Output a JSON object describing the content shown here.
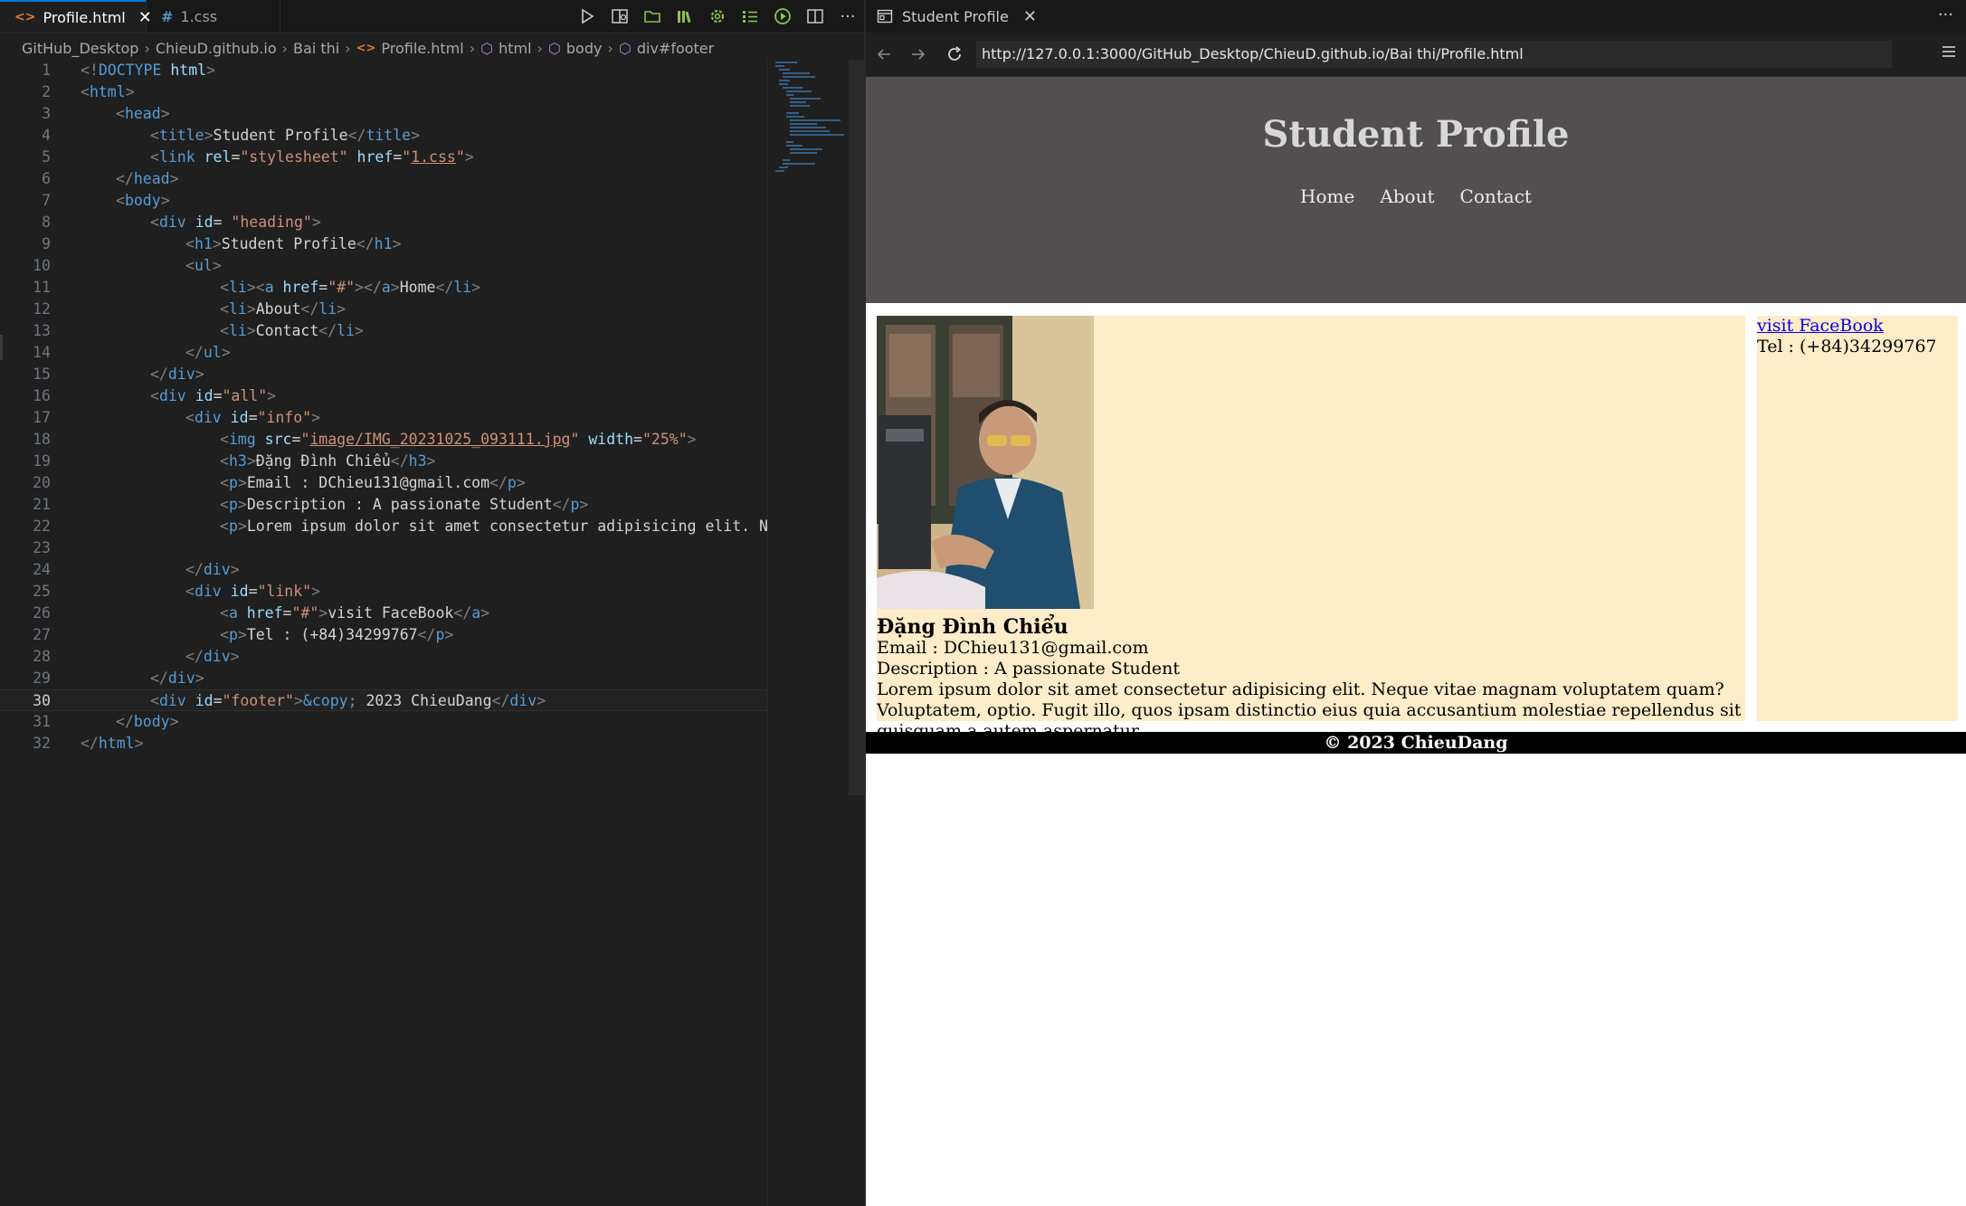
{
  "editor": {
    "tabs": [
      {
        "icon": "<>",
        "label": "Profile.html",
        "active": true
      },
      {
        "icon": "#",
        "label": "1.css",
        "active": false
      }
    ],
    "breadcrumb": [
      "GitHub_Desktop",
      "ChieuD.github.io",
      "Bai thi",
      "Profile.html",
      "html",
      "body",
      "div#footer"
    ],
    "current_line": 30,
    "line_numbers": [
      "1",
      "2",
      "3",
      "4",
      "5",
      "6",
      "7",
      "8",
      "9",
      "10",
      "11",
      "12",
      "13",
      "14",
      "15",
      "16",
      "17",
      "18",
      "19",
      "20",
      "21",
      "22",
      "23",
      "24",
      "25",
      "26",
      "27",
      "28",
      "29",
      "30",
      "31",
      "32"
    ]
  },
  "code": {
    "l1": {
      "a": "<!",
      "b": "DOCTYPE",
      "c": " html",
      "d": ">"
    },
    "l2": {
      "a": "<",
      "b": "html",
      "c": ">"
    },
    "l3": {
      "a": "<",
      "b": "head",
      "c": ">"
    },
    "l4": {
      "a": "<",
      "b": "title",
      "c": ">",
      "d": "Student Profile",
      "e": "</",
      "f": "title",
      "g": ">"
    },
    "l5": {
      "a": "<",
      "b": "link",
      "c": " rel",
      "d": "=",
      "e": "\"stylesheet\"",
      "f": " href",
      "g": "=",
      "h": "\"",
      "i": "1.css",
      "j": "\"",
      "k": ">"
    },
    "l6": {
      "a": "</",
      "b": "head",
      "c": ">"
    },
    "l7": {
      "a": "<",
      "b": "body",
      "c": ">"
    },
    "l8": {
      "a": "<",
      "b": "div",
      "c": " id",
      "d": "=",
      "e": " \"heading\"",
      "f": ">"
    },
    "l9": {
      "a": "<",
      "b": "h1",
      "c": ">",
      "d": "Student Profile",
      "e": "</",
      "f": "h1",
      "g": ">"
    },
    "l10": {
      "a": "<",
      "b": "ul",
      "c": ">"
    },
    "l11": {
      "a": "<",
      "b": "li",
      "c": "><",
      "d": "a",
      "e": " href",
      "f": "=",
      "g": "\"#\"",
      "h": "></",
      "i": "a",
      "j": ">",
      "k": "Home",
      "l": "</",
      "m": "li",
      "n": ">"
    },
    "l12": {
      "a": "<",
      "b": "li",
      "c": ">",
      "d": "About",
      "e": "</",
      "f": "li",
      "g": ">"
    },
    "l13": {
      "a": "<",
      "b": "li",
      "c": ">",
      "d": "Contact",
      "e": "</",
      "f": "li",
      "g": ">"
    },
    "l14": {
      "a": "</",
      "b": "ul",
      "c": ">"
    },
    "l15": {
      "a": "</",
      "b": "div",
      "c": ">"
    },
    "l16": {
      "a": "<",
      "b": "div",
      "c": " id",
      "d": "=",
      "e": "\"all\"",
      "f": ">"
    },
    "l17": {
      "a": "<",
      "b": "div",
      "c": " id",
      "d": "=",
      "e": "\"info\"",
      "f": ">"
    },
    "l18": {
      "a": "<",
      "b": "img",
      "c": " src",
      "d": "=",
      "e": "\"",
      "f": "image/IMG_20231025_093111.jpg",
      "g": "\"",
      "h": " width",
      "i": "=",
      "j": "\"25%\"",
      "k": ">"
    },
    "l19": {
      "a": "<",
      "b": "h3",
      "c": ">",
      "d": "Đặng Đình Chiểu",
      "e": "</",
      "f": "h3",
      "g": ">"
    },
    "l20": {
      "a": "<",
      "b": "p",
      "c": ">",
      "d": "Email : DChieu131@gmail.com",
      "e": "</",
      "f": "p",
      "g": ">"
    },
    "l21": {
      "a": "<",
      "b": "p",
      "c": ">",
      "d": "Description : A passionate Student",
      "e": "</",
      "f": "p",
      "g": ">"
    },
    "l22": {
      "a": "<",
      "b": "p",
      "c": ">",
      "d": "Lorem ipsum dolor sit amet consectetur adipisicing elit. Neq"
    },
    "l24": {
      "a": "</",
      "b": "div",
      "c": ">"
    },
    "l25": {
      "a": "<",
      "b": "div",
      "c": " id",
      "d": "=",
      "e": "\"link\"",
      "f": ">"
    },
    "l26": {
      "a": "<",
      "b": "a",
      "c": " href",
      "d": "=",
      "e": "\"#\"",
      "f": ">",
      "g": "visit FaceBook",
      "h": "</",
      "i": "a",
      "j": ">"
    },
    "l27": {
      "a": "<",
      "b": "p",
      "c": ">",
      "d": "Tel : (+84)34299767",
      "e": "</",
      "f": "p",
      "g": ">"
    },
    "l28": {
      "a": "</",
      "b": "div",
      "c": ">"
    },
    "l29": {
      "a": "</",
      "b": "div",
      "c": ">"
    },
    "l30": {
      "a": "<",
      "b": "div",
      "c": " id",
      "d": "=",
      "e": "\"footer\"",
      "f": ">",
      "g": "&copy;",
      "h": " 2023 ChieuDang",
      "i": "</",
      "j": "div",
      "k": ">"
    },
    "l31": {
      "a": "</",
      "b": "body",
      "c": ">"
    },
    "l32": {
      "a": "</",
      "b": "html",
      "c": ">"
    }
  },
  "browser": {
    "tab_title": "Student Profile",
    "url": "http://127.0.0.1:3000/GitHub_Desktop/ChieuD.github.io/Bai thi/Profile.html"
  },
  "page": {
    "heading": "Student Profile",
    "nav": [
      "Home",
      "About",
      "Contact"
    ],
    "name": "Đặng Đình Chiểu",
    "email": "Email : DChieu131@gmail.com",
    "description": "Description : A passionate Student",
    "lorem": "Lorem ipsum dolor sit amet consectetur adipisicing elit. Neque vitae magnam voluptatem quam? Voluptatem, optio. Fugit illo, quos ipsam distinctio eius quia accusantium molestiae repellendus sit quisquam a autem aspernatur.",
    "facebook_link": "visit FaceBook",
    "tel": "Tel : (+84)34299767",
    "footer": "© 2023 ChieuDang"
  },
  "colors": {
    "editor_bg": "#1f1f1f",
    "header_bg": "#534f50",
    "card_bg": "#ffecc9",
    "footer_bg": "#000000",
    "accent": "#0078d4"
  }
}
